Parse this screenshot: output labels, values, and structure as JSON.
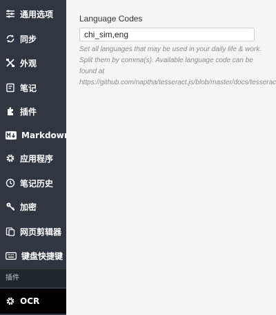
{
  "sidebar": {
    "items": [
      {
        "label": "通用选项",
        "icon": "sliders-icon"
      },
      {
        "label": "同步",
        "icon": "sync-icon"
      },
      {
        "label": "外观",
        "icon": "brush-icon"
      },
      {
        "label": "笔记",
        "icon": "note-icon"
      },
      {
        "label": "插件",
        "icon": "puzzle-icon"
      },
      {
        "label": "Markdown",
        "icon": "markdown-icon"
      },
      {
        "label": "应用程序",
        "icon": "gear-icon"
      },
      {
        "label": "笔记历史",
        "icon": "history-icon"
      },
      {
        "label": "加密",
        "icon": "key-icon"
      },
      {
        "label": "网页剪辑器",
        "icon": "clipper-icon"
      },
      {
        "label": "键盘快捷键",
        "icon": "keyboard-icon"
      }
    ],
    "section_header": "插件",
    "active_item": {
      "label": "OCR",
      "icon": "gear-icon"
    }
  },
  "main": {
    "field_label": "Language Codes",
    "field_value": "chi_sim,eng",
    "help_lines": [
      "Set all languages that may be used in your daily life & work.",
      "Split them by comma(s). Available language code can be",
      "found at",
      "https://github.com/naptha/tesseract.js/blob/master/docs/tesseract"
    ]
  },
  "colors": {
    "sidebar_bg": "#313640",
    "section_bg": "#22262d",
    "active_bg": "#000000",
    "main_bg": "#f5f5f5"
  }
}
